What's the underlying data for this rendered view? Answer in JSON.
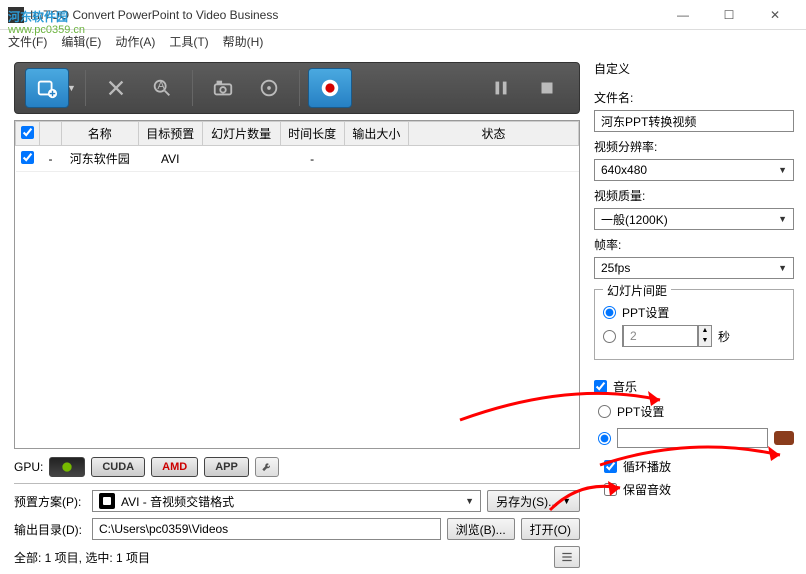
{
  "window": {
    "title": "ImTOO Convert PowerPoint to Video Business",
    "min": "—",
    "max": "☐",
    "close": "✕"
  },
  "watermark": {
    "main": "河东软件园",
    "url": "www.pc0359.cn"
  },
  "menu": {
    "file": "文件(F)",
    "edit": "编辑(E)",
    "action": "动作(A)",
    "tools": "工具(T)",
    "help": "帮助(H)"
  },
  "table": {
    "headers": {
      "check": "",
      "name": "名称",
      "target": "目标预置",
      "slides": "幻灯片数量",
      "duration": "时间长度",
      "outsize": "输出大小",
      "status": "状态"
    },
    "rows": [
      {
        "checked": true,
        "idx": "-",
        "name": "河东软件园",
        "target": "AVI",
        "slides": "",
        "duration": "-",
        "outsize": "",
        "status": ""
      }
    ]
  },
  "gpu": {
    "label": "GPU:",
    "nvidia": "●",
    "cuda": "CUDA",
    "amd": "AMD",
    "app": "APP"
  },
  "bottom": {
    "profile_label": "预置方案(P):",
    "profile_value": "AVI - 音视频交错格式",
    "saveas": "另存为(S)...",
    "outdir_label": "输出目录(D):",
    "outdir_value": "C:\\Users\\pc0359\\Videos",
    "browse": "浏览(B)...",
    "open": "打开(O)",
    "status": "全部: 1 项目, 选中: 1 项目"
  },
  "right": {
    "title": "自定义",
    "filename_label": "文件名:",
    "filename_value": "河东PPT转换视频",
    "res_label": "视频分辨率:",
    "res_value": "640x480",
    "quality_label": "视频质量:",
    "quality_value": "一般(1200K)",
    "fps_label": "帧率:",
    "fps_value": "25fps",
    "interval_legend": "幻灯片间距",
    "interval_ppt": "PPT设置",
    "interval_seconds_value": "2",
    "interval_seconds_unit": "秒",
    "music_check": "音乐",
    "music_ppt": "PPT设置",
    "loop": "循环播放",
    "keep_audio": "保留音效"
  }
}
